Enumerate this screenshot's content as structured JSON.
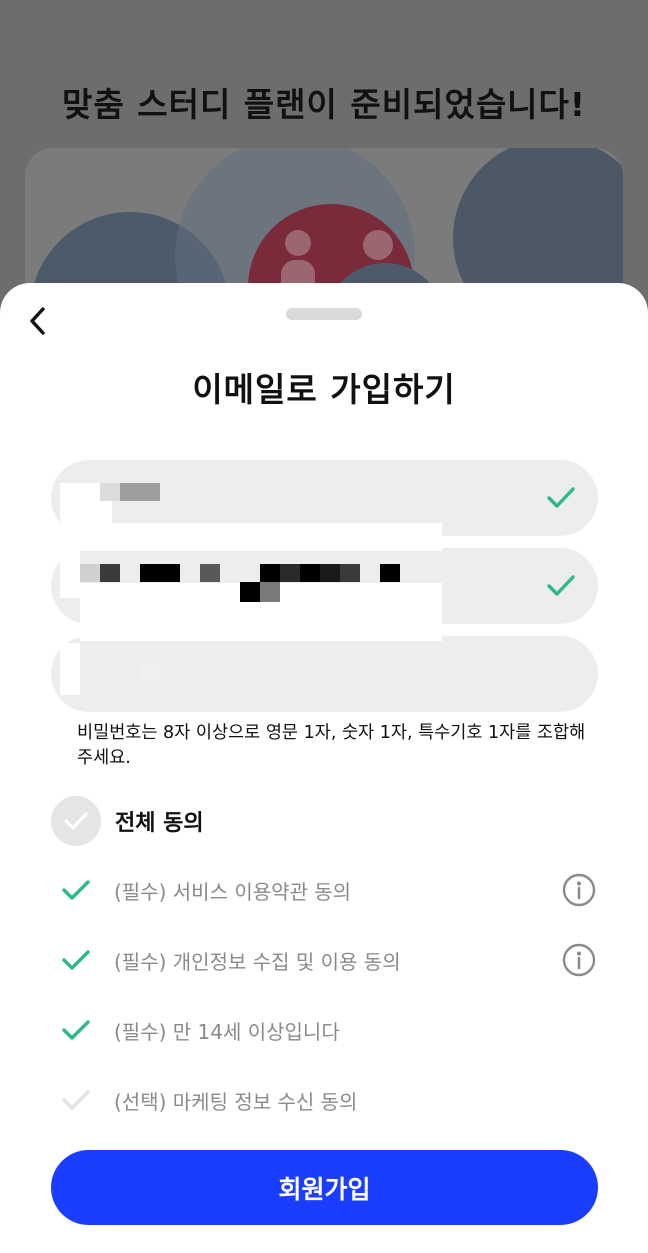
{
  "background": {
    "title": "맞춤 스터디 플랜이 준비되었습니다!"
  },
  "sheet": {
    "title": "이메일로 가입하기",
    "back_icon": "chevron-left-icon",
    "fields": [
      {
        "value": "",
        "valid": true
      },
      {
        "value": "",
        "valid": true
      },
      {
        "value": "",
        "valid": false
      }
    ],
    "password_hint": "비밀번호는 8자 이상으로 영문 1자, 숫자 1자, 특수기호 1자를 조합해 주세요.",
    "agree_all": {
      "label": "전체 동의",
      "checked": false
    },
    "terms": [
      {
        "label": "(필수) 서비스 이용약관 동의",
        "checked": true,
        "has_info": true
      },
      {
        "label": "(필수) 개인정보 수집 및 이용 동의",
        "checked": true,
        "has_info": true
      },
      {
        "label": "(필수) 만 14세 이상입니다",
        "checked": true,
        "has_info": false
      },
      {
        "label": "(선택) 마케팅 정보 수신 동의",
        "checked": false,
        "has_info": false
      }
    ],
    "submit_label": "회원가입"
  },
  "colors": {
    "primary": "#1a3dff",
    "check_active": "#2bb88a",
    "check_inactive": "#e3e3e6",
    "field_bg": "#ededf0",
    "term_text": "#8a8a8a"
  }
}
